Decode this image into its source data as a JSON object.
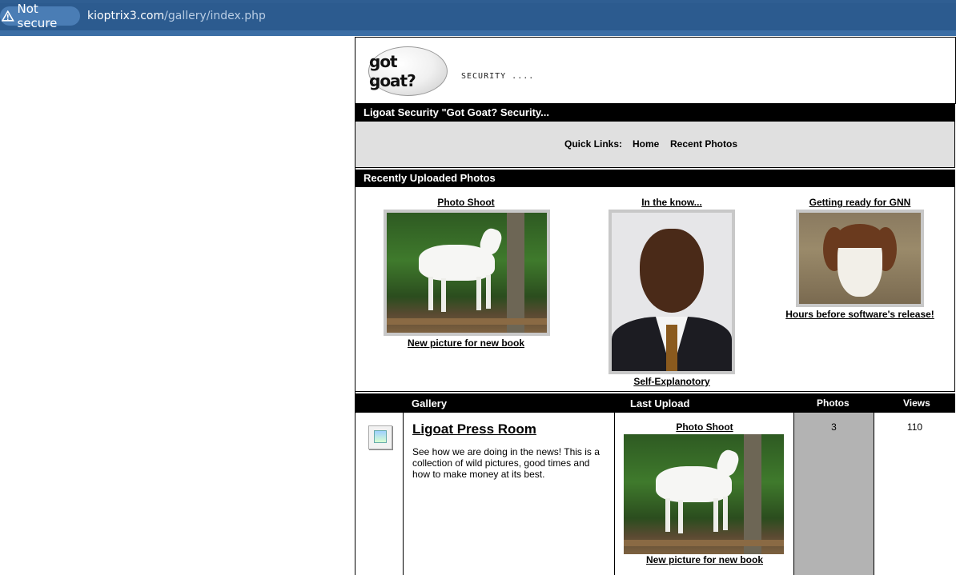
{
  "browser": {
    "security_label": "Not secure",
    "url_host": "kioptrix3.com",
    "url_path": "/gallery/index.php"
  },
  "header": {
    "logo_text": "got goat?",
    "tagline": "SECURITY ...."
  },
  "site_title": "Ligoat Security \"Got Goat? Security...",
  "quick_links": {
    "label": "Quick Links:",
    "home": "Home",
    "recent": "Recent Photos"
  },
  "recent": {
    "heading": "Recently Uploaded Photos",
    "photos": [
      {
        "title": "Photo Shoot",
        "caption": "New picture for new book"
      },
      {
        "title": "In the know...",
        "caption": "Self-Explanotory"
      },
      {
        "title": "Getting ready for GNN",
        "caption": "Hours before software's release!"
      }
    ]
  },
  "gallery_table": {
    "headers": {
      "gallery": "Gallery",
      "last_upload": "Last Upload",
      "photos": "Photos",
      "views": "Views"
    },
    "rows": [
      {
        "name": "Ligoat Press Room",
        "description": "See how we are doing in the news! This is a collection of wild pictures, good times and how to make money at its best.",
        "last_title": "Photo Shoot",
        "last_caption": "New picture for new book",
        "photos": "3",
        "views": "110"
      }
    ]
  }
}
